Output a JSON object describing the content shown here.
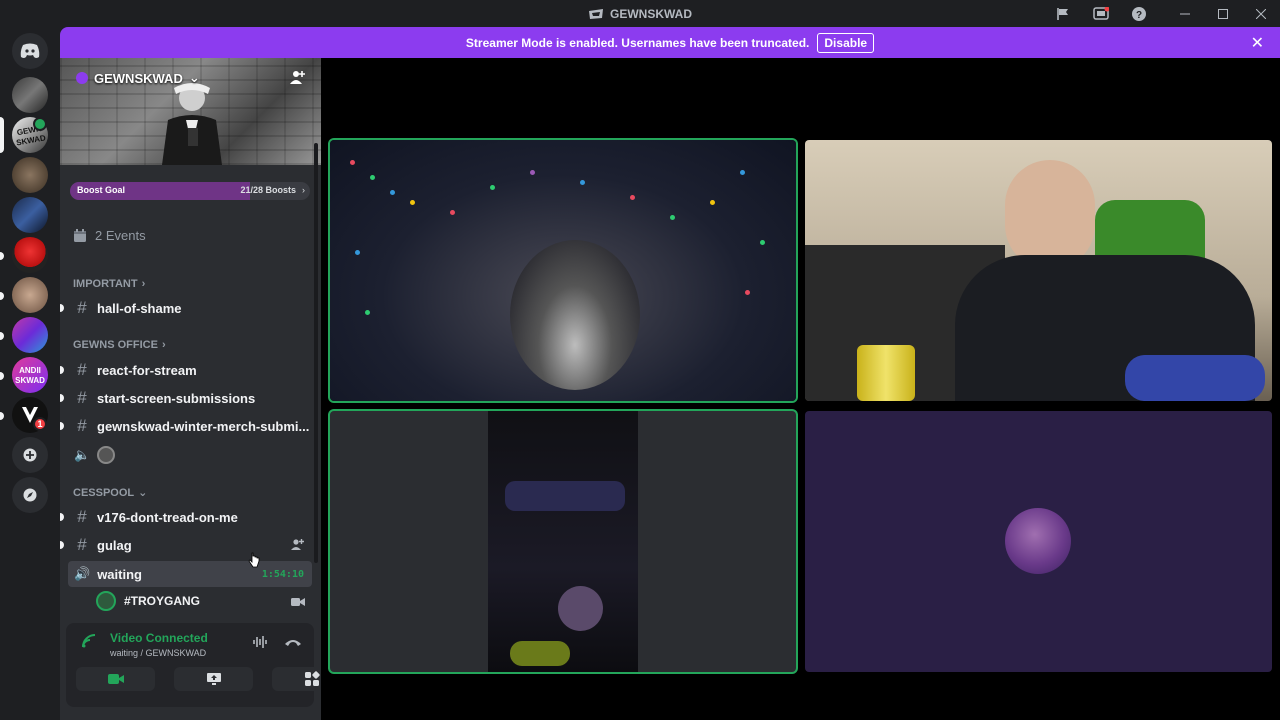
{
  "window": {
    "title": "GEWNSKWAD"
  },
  "banner": {
    "text": "Streamer Mode is enabled. Usernames have been truncated.",
    "button": "Disable"
  },
  "server": {
    "name": "GEWNSKWAD",
    "boost": {
      "label": "Boost Goal",
      "count": "21/28 Boosts",
      "progress": 0.75
    },
    "events": "2 Events"
  },
  "categories": {
    "important": "IMPORTANT",
    "office": "GEWNS OFFICE",
    "cesspool": "CESSPOOL"
  },
  "channels": {
    "hall": "hall-of-shame",
    "react": "react-for-stream",
    "start": "start-screen-submissions",
    "merch": "gewnskwad-winter-merch-submi...",
    "v176": "v176-dont-tread-on-me",
    "gulag": "gulag",
    "waiting": "waiting",
    "waiting_time": "1:54:10",
    "voice_user": "#TROYGANG"
  },
  "voice_panel": {
    "status": "Video Connected",
    "location": "waiting / GEWNSKWAD"
  },
  "colors": {
    "accent": "#8c3cef",
    "online": "#23a55a",
    "badge": "#f23f43"
  }
}
